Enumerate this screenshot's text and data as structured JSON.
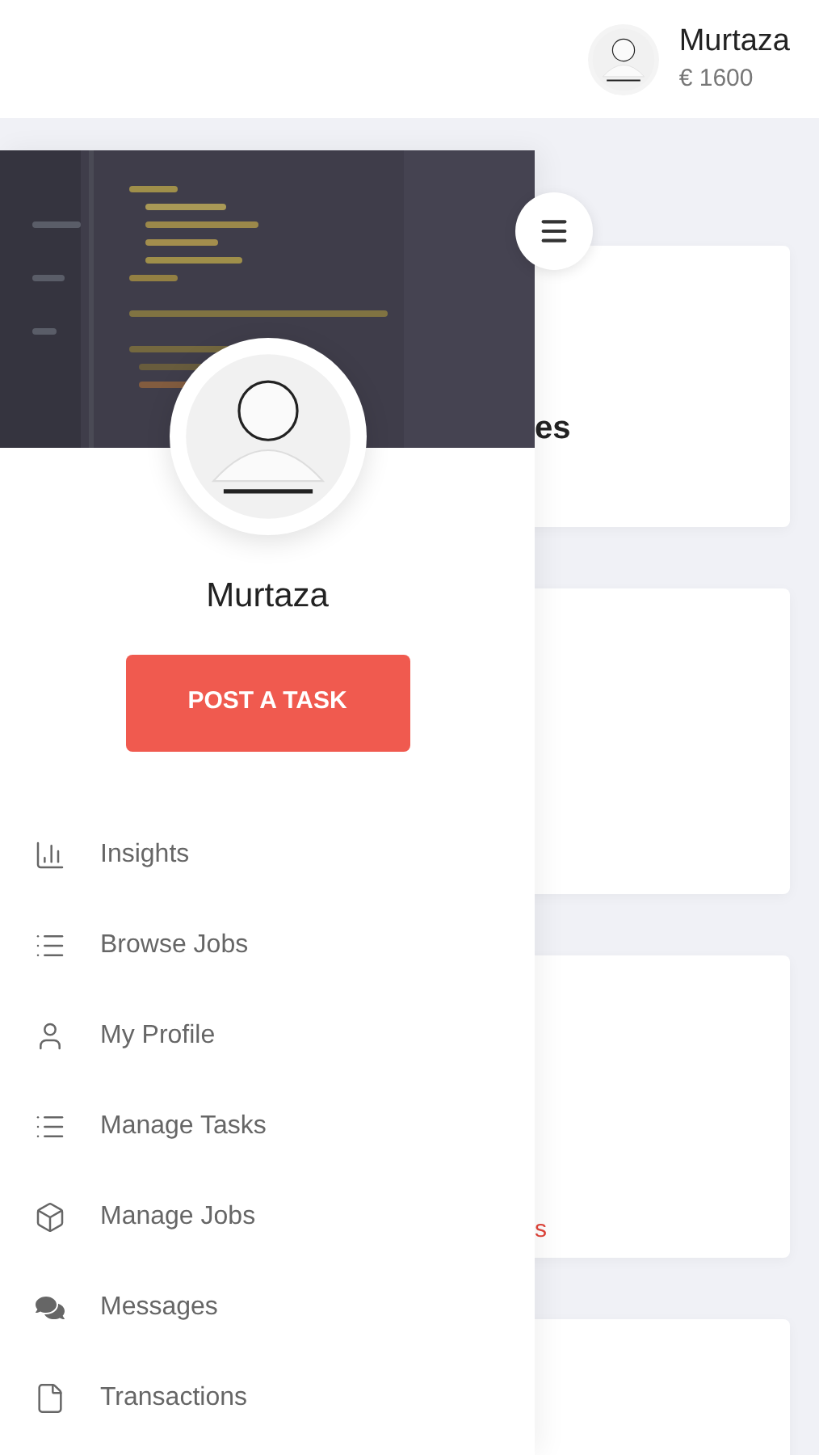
{
  "header": {
    "name": "Murtaza",
    "balance": "€ 1600"
  },
  "cards": [
    {
      "kind": "heading",
      "text": "es"
    },
    {
      "kind": "blank"
    },
    {
      "kind": "link",
      "text": "s"
    },
    {
      "kind": "blank"
    }
  ],
  "drawer": {
    "name": "Murtaza",
    "button": "POST A TASK",
    "items": [
      {
        "label": "Insights"
      },
      {
        "label": "Browse Jobs"
      },
      {
        "label": "My Profile"
      },
      {
        "label": "Manage Tasks"
      },
      {
        "label": "Manage Jobs"
      },
      {
        "label": "Messages"
      },
      {
        "label": "Transactions"
      }
    ]
  }
}
